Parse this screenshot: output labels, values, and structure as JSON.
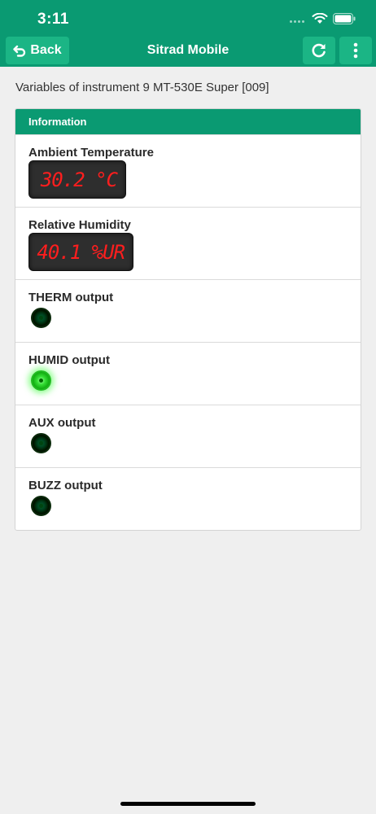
{
  "status_bar": {
    "time": "3:11"
  },
  "nav": {
    "back_label": "Back",
    "title": "Sitrad Mobile"
  },
  "page": {
    "heading": "Variables of instrument 9 MT-530E Super [009]"
  },
  "panel": {
    "header": "Information",
    "analog": [
      {
        "label": "Ambient Temperature",
        "value": "30.2 °C"
      },
      {
        "label": "Relative Humidity",
        "value": "40.1 %UR"
      }
    ],
    "outputs": [
      {
        "label": "THERM output",
        "state": "off"
      },
      {
        "label": "HUMID output",
        "state": "on"
      },
      {
        "label": "AUX output",
        "state": "off"
      },
      {
        "label": "BUZZ output",
        "state": "off"
      }
    ]
  },
  "colors": {
    "brand": "#0a9a72",
    "button": "#1bb585",
    "display_text": "#ff1e1e",
    "led_on": "#33dd33"
  }
}
